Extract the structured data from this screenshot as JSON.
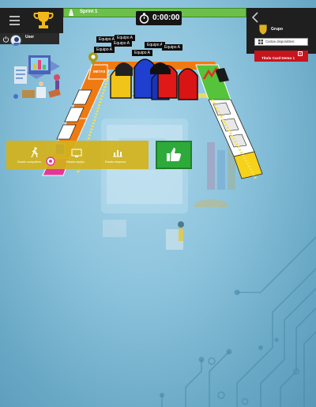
{
  "colors": {
    "sprint_bar": "#6cc04a",
    "panel": "#1f1f1f",
    "demo_card": "#c8141c",
    "yellow_bar": "#d4b21a",
    "green_button": "#2eaa3a",
    "team_blue": "#1e3fd0",
    "team_red": "#e01818",
    "team_yellow": "#f0c418",
    "track_orange": "#f07a12",
    "track_green": "#55c43a"
  },
  "top_left": {
    "menu_icon": "hamburger-menu-icon",
    "trophy_icon": "trophy-icon",
    "user_name": "User"
  },
  "sprint": {
    "label": "Sprint 1",
    "icon": "flag-road-icon"
  },
  "timer": {
    "value": "0:00:00",
    "icon": "stopwatch-icon"
  },
  "right_panel": {
    "back_icon": "chevron-left-icon",
    "group_label": "Grupo",
    "cards_label": "Cartas disponibles:",
    "demo_card_label": "Titulo Card Demo 1",
    "close_glyph": "×"
  },
  "board": {
    "start_label": "METAS",
    "teams": [
      {
        "label": "Equipo A"
      },
      {
        "label": "Equipo A"
      },
      {
        "label": "Equipo A"
      },
      {
        "label": "Equipo A"
      },
      {
        "label": "Equipo A"
      },
      {
        "label": "Equipo A"
      },
      {
        "label": "Equipo A"
      }
    ]
  },
  "stats": [
    {
      "label": "Estado compañero",
      "icon": "walking-person-icon"
    },
    {
      "label": "Estado equipo",
      "icon": "team-monitor-icon"
    },
    {
      "label": "Estado empresa",
      "icon": "bar-chart-icon"
    }
  ],
  "thumbs_icon": "thumbs-up-icon"
}
